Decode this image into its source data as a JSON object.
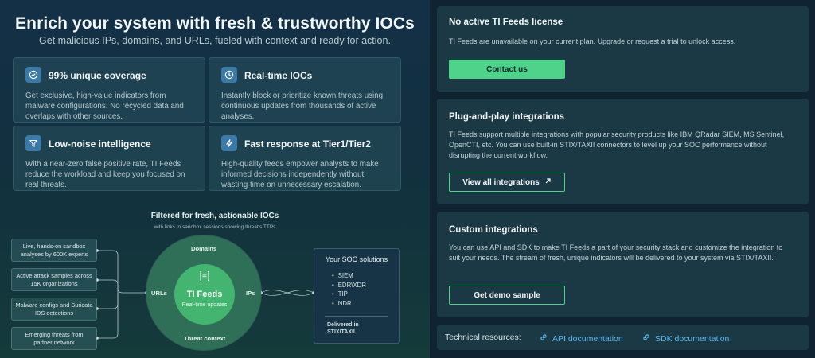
{
  "hero": {
    "title": "Enrich your system with fresh & trustworthy IOCs",
    "subtitle": "Get malicious IPs, domains, and URLs, fueled with context and ready for action."
  },
  "features": [
    {
      "icon": "check-circle-icon",
      "title": "99% unique coverage",
      "desc": "Get exclusive, high-value indicators from malware configurations. No recycled data and overlaps with other sources."
    },
    {
      "icon": "clock-icon",
      "title": "Real-time IOCs",
      "desc": "Instantly block or prioritize known threats using continuous updates from thousands of active analyses."
    },
    {
      "icon": "filter-icon",
      "title": "Low-noise intelligence",
      "desc": "With a near-zero false positive rate, TI Feeds reduce the workload and keep you focused on real threats."
    },
    {
      "icon": "lightning-icon",
      "title": "Fast response at Tier1/Tier2",
      "desc": "High-quality feeds empower analysts to make informed decisions independently without wasting time on unnecessary escalation."
    }
  ],
  "diagram": {
    "title": "Filtered for fresh, actionable IOCs",
    "subtitle": "with links to sandbox sessions showing threat's TTPs",
    "sources": [
      "Live, hands-on sandbox analyses by 600K experts",
      "Active attack samples across 15K organizations",
      "Malware configs and Suricata IDS detections",
      "Emerging threats from partner network"
    ],
    "core_title": "TI Feeds",
    "core_sub": "Real-time updates",
    "ring_top": "Domains",
    "ring_bottom": "Threat context",
    "ring_left": "URLs",
    "ring_right": "IPs",
    "soc_title": "Your SOC solutions",
    "soc_items": [
      "SIEM",
      "EDR\\XDR",
      "TIP",
      "NDR"
    ],
    "soc_foot": "Delivered in STIX/TAXII"
  },
  "license_card": {
    "title": "No active TI Feeds license",
    "desc": "TI Feeds are unavailable on your current plan. Upgrade or request a trial to unlock access.",
    "button": "Contact us"
  },
  "integrations_card": {
    "title": "Plug-and-play integrations",
    "desc": "TI Feeds support multiple integrations with popular security products like IBM QRadar SIEM, MS Sentinel, OpenCTI, etc. You can use built-in STIX/TAXII connectors to level up your SOC performance without disrupting the current workflow.",
    "button": "View all integrations"
  },
  "custom_card": {
    "title": "Custom integrations",
    "desc": "You can use API and SDK to make TI Feeds a part of your security stack and customize the integration to suit your needs. The stream of fresh, unique indicators will be delivered to your system via STIX/TAXII.",
    "button": "Get demo sample"
  },
  "resources": {
    "label": "Technical resources:",
    "api_link": "API documentation",
    "sdk_link": "SDK documentation"
  },
  "colors": {
    "accent_green": "#4fd38a",
    "core_green": "#43b571",
    "link_blue": "#5ab8f0",
    "icon_blue": "#3b79a6"
  }
}
